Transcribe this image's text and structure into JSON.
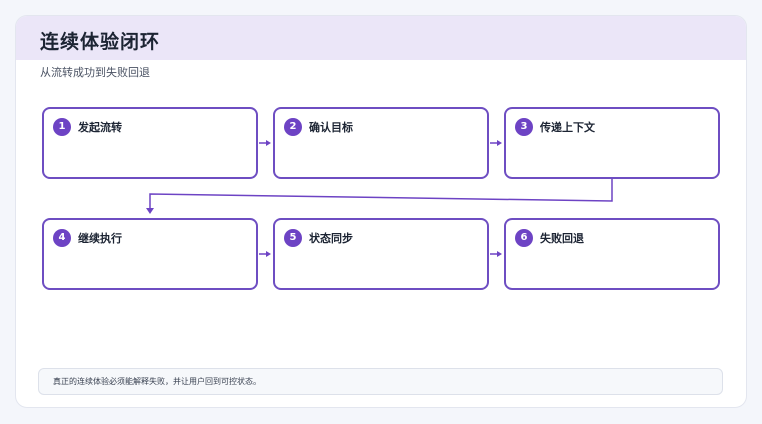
{
  "header": {
    "title": "连续体验闭环",
    "subtitle": "从流转成功到失败回退"
  },
  "steps": [
    {
      "num": "1",
      "label": "发起流转"
    },
    {
      "num": "2",
      "label": "确认目标"
    },
    {
      "num": "3",
      "label": "传递上下文"
    },
    {
      "num": "4",
      "label": "继续执行"
    },
    {
      "num": "5",
      "label": "状态同步"
    },
    {
      "num": "6",
      "label": "失败回退"
    }
  ],
  "note": "真正的连续体验必须能解释失败，并让用户回到可控状态。",
  "colors": {
    "accent": "#6d43c4",
    "border": "#6e4ec2",
    "header_band": "#ebe6f8",
    "text": "#1c2433"
  }
}
